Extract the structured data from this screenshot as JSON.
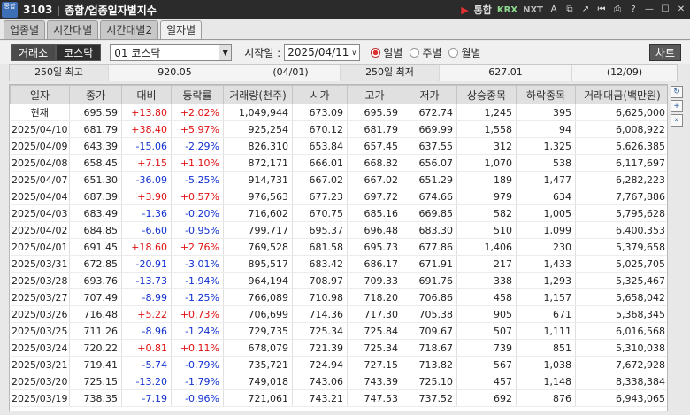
{
  "titlebar": {
    "app_badge": "종합",
    "code": "3103",
    "title": "종합/업종일자별지수",
    "btn_integrated": "통합",
    "btn_krx": "KRX",
    "btn_nxt": "NXT"
  },
  "tabs": [
    {
      "label": "업종별"
    },
    {
      "label": "시간대별"
    },
    {
      "label": "시간대별2"
    },
    {
      "label": "일자별"
    }
  ],
  "toolbar": {
    "market_kospi": "거래소",
    "market_kosdaq": "코스닥",
    "sector_value": "01  코스닥",
    "start_label": "시작일 :",
    "start_date": "2025/04/11",
    "radio_daily": "일별",
    "radio_weekly": "주별",
    "radio_monthly": "월별",
    "chart_button": "차트"
  },
  "summary": {
    "high_label": "250일 최고",
    "high_value": "920.05",
    "high_date": "(04/01)",
    "low_label": "250일 최저",
    "low_value": "627.01",
    "low_date": "(12/09)"
  },
  "table": {
    "headers": [
      "일자",
      "종가",
      "대비",
      "등락률",
      "거래량(천주)",
      "시가",
      "고가",
      "저가",
      "상승종목",
      "하락종목",
      "거래대금(백만원)"
    ],
    "rows": [
      [
        "현재",
        "695.59",
        "+13.80",
        "+2.02%",
        "1,049,944",
        "673.09",
        "695.59",
        "672.74",
        "1,245",
        "395",
        "6,625,000"
      ],
      [
        "2025/04/10",
        "681.79",
        "+38.40",
        "+5.97%",
        "925,254",
        "670.12",
        "681.79",
        "669.99",
        "1,558",
        "94",
        "6,008,922"
      ],
      [
        "2025/04/09",
        "643.39",
        "-15.06",
        "-2.29%",
        "826,310",
        "653.84",
        "657.45",
        "637.55",
        "312",
        "1,325",
        "5,626,385"
      ],
      [
        "2025/04/08",
        "658.45",
        "+7.15",
        "+1.10%",
        "872,171",
        "666.01",
        "668.82",
        "656.07",
        "1,070",
        "538",
        "6,117,697"
      ],
      [
        "2025/04/07",
        "651.30",
        "-36.09",
        "-5.25%",
        "914,731",
        "667.02",
        "667.02",
        "651.29",
        "189",
        "1,477",
        "6,282,223"
      ],
      [
        "2025/04/04",
        "687.39",
        "+3.90",
        "+0.57%",
        "976,563",
        "677.23",
        "697.72",
        "674.66",
        "979",
        "634",
        "7,767,886"
      ],
      [
        "2025/04/03",
        "683.49",
        "-1.36",
        "-0.20%",
        "716,602",
        "670.75",
        "685.16",
        "669.85",
        "582",
        "1,005",
        "5,795,628"
      ],
      [
        "2025/04/02",
        "684.85",
        "-6.60",
        "-0.95%",
        "799,717",
        "695.37",
        "696.48",
        "683.30",
        "510",
        "1,099",
        "6,400,353"
      ],
      [
        "2025/04/01",
        "691.45",
        "+18.60",
        "+2.76%",
        "769,528",
        "681.58",
        "695.73",
        "677.86",
        "1,406",
        "230",
        "5,379,658"
      ],
      [
        "2025/03/31",
        "672.85",
        "-20.91",
        "-3.01%",
        "895,517",
        "683.42",
        "686.17",
        "671.91",
        "217",
        "1,433",
        "5,025,705"
      ],
      [
        "2025/03/28",
        "693.76",
        "-13.73",
        "-1.94%",
        "964,194",
        "708.97",
        "709.33",
        "691.76",
        "338",
        "1,293",
        "5,325,467"
      ],
      [
        "2025/03/27",
        "707.49",
        "-8.99",
        "-1.25%",
        "766,089",
        "710.98",
        "718.20",
        "706.86",
        "458",
        "1,157",
        "5,658,042"
      ],
      [
        "2025/03/26",
        "716.48",
        "+5.22",
        "+0.73%",
        "706,699",
        "714.36",
        "717.30",
        "705.38",
        "905",
        "671",
        "5,368,345"
      ],
      [
        "2025/03/25",
        "711.26",
        "-8.96",
        "-1.24%",
        "729,735",
        "725.34",
        "725.84",
        "709.67",
        "507",
        "1,111",
        "6,016,568"
      ],
      [
        "2025/03/24",
        "720.22",
        "+0.81",
        "+0.11%",
        "678,079",
        "721.39",
        "725.34",
        "718.67",
        "739",
        "851",
        "5,310,038"
      ],
      [
        "2025/03/21",
        "719.41",
        "-5.74",
        "-0.79%",
        "735,721",
        "724.94",
        "727.15",
        "713.82",
        "567",
        "1,038",
        "7,672,928"
      ],
      [
        "2025/03/20",
        "725.15",
        "-13.20",
        "-1.79%",
        "749,018",
        "743.06",
        "743.39",
        "725.10",
        "457",
        "1,148",
        "8,338,384"
      ],
      [
        "2025/03/19",
        "738.35",
        "-7.19",
        "-0.96%",
        "721,061",
        "743.21",
        "747.53",
        "737.52",
        "692",
        "876",
        "6,943,065"
      ]
    ]
  },
  "colors": {
    "up": "#e01010",
    "down": "#1030d0"
  }
}
